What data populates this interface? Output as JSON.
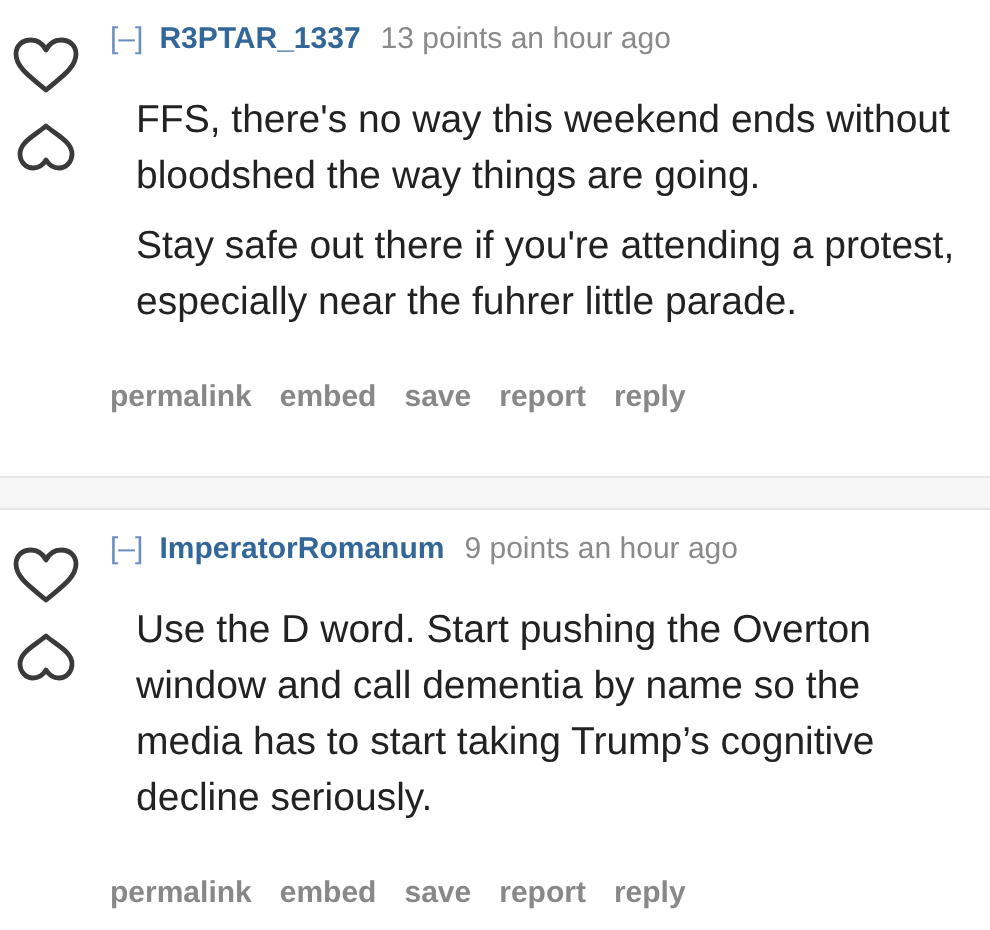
{
  "comments": [
    {
      "collapse": "[–]",
      "author": "R3PTAR_1337",
      "meta": "13 points an hour ago",
      "paragraphs": [
        "FFS, there's no way this weekend ends without bloodshed the way things are going.",
        "Stay safe out there if you're attending a protest, especially near the fuhrer little parade."
      ],
      "actions": [
        "permalink",
        "embed",
        "save",
        "report",
        "reply"
      ]
    },
    {
      "collapse": "[–]",
      "author": "ImperatorRomanum",
      "meta": "9 points an hour ago",
      "paragraphs": [
        "Use the D word. Start pushing the Overton window and call dementia by name so the media has to start taking Trump’s cognitive decline seriously."
      ],
      "actions": [
        "permalink",
        "embed",
        "save",
        "report",
        "reply"
      ]
    }
  ]
}
